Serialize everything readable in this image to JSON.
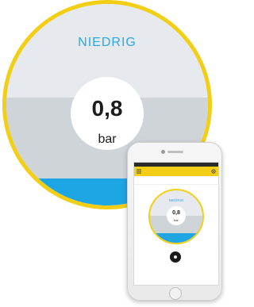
{
  "gauge": {
    "level_label": "NIEDRIG",
    "value": "0,8",
    "unit": "bar"
  },
  "phone": {
    "app_bar_title": "",
    "tabs": [
      "",
      "",
      ""
    ],
    "gauge_level_label": "NIEDRIG",
    "gauge_value": "0,8",
    "gauge_unit": "bar",
    "caption": ""
  },
  "colors": {
    "accent_yellow": "#f2cf16",
    "level_blue": "#1ea6e4",
    "label_blue": "#2ca8df",
    "band_light": "#e6e9ee",
    "band_mid": "#cfd4d9"
  }
}
